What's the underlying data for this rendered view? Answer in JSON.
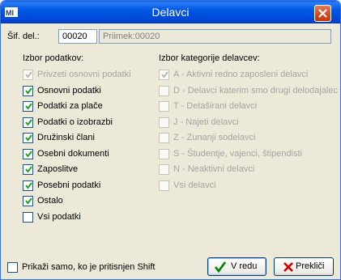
{
  "window": {
    "title": "Delavci"
  },
  "header": {
    "sif_label": "Šif. del.:",
    "sif_value": "00020",
    "name_value": "Priimek:00020"
  },
  "left_group": {
    "title": "Izbor podatkov:",
    "items": [
      {
        "label": "Privzeti osnovni podatki",
        "checked": true,
        "enabled": false
      },
      {
        "label": "Osnovni podatki",
        "checked": true,
        "enabled": true
      },
      {
        "label": "Podatki za plače",
        "checked": true,
        "enabled": true
      },
      {
        "label": "Podatki o izobrazbi",
        "checked": true,
        "enabled": true
      },
      {
        "label": "Družinski člani",
        "checked": true,
        "enabled": true
      },
      {
        "label": "Osebni dokumenti",
        "checked": true,
        "enabled": true
      },
      {
        "label": "Zaposlitve",
        "checked": true,
        "enabled": true
      },
      {
        "label": "Posebni podatki",
        "checked": true,
        "enabled": true
      },
      {
        "label": "Ostalo",
        "checked": true,
        "enabled": true
      },
      {
        "label": "Vsi podatki",
        "checked": false,
        "enabled": true
      }
    ]
  },
  "right_group": {
    "title": "Izbor kategorije delavcev:",
    "items": [
      {
        "label": "A - Aktivni redno zaposleni delavci",
        "checked": true,
        "enabled": false
      },
      {
        "label": "D - Delavci katerim smo drugi delodajalec",
        "checked": false,
        "enabled": false
      },
      {
        "label": "T - Detaširani delavci",
        "checked": false,
        "enabled": false
      },
      {
        "label": "J - Najeti delavci",
        "checked": false,
        "enabled": false
      },
      {
        "label": "Z - Zunanji sodelavci",
        "checked": false,
        "enabled": false
      },
      {
        "label": "S - Študentje, vajenci, štipendisti",
        "checked": false,
        "enabled": false
      },
      {
        "label": "N - Neaktivni delavci",
        "checked": false,
        "enabled": false
      },
      {
        "label": "Vsi delavci",
        "checked": false,
        "enabled": false
      }
    ]
  },
  "footer": {
    "shift_label": "Prikaži samo, ko je pritisnjen Shift",
    "shift_checked": false,
    "ok_label": "V redu",
    "cancel_label": "Prekliči"
  },
  "colors": {
    "titlebar": "#0054e3",
    "face": "#ece9d8",
    "ok_icon": "#008000",
    "cancel_icon": "#d40000"
  }
}
